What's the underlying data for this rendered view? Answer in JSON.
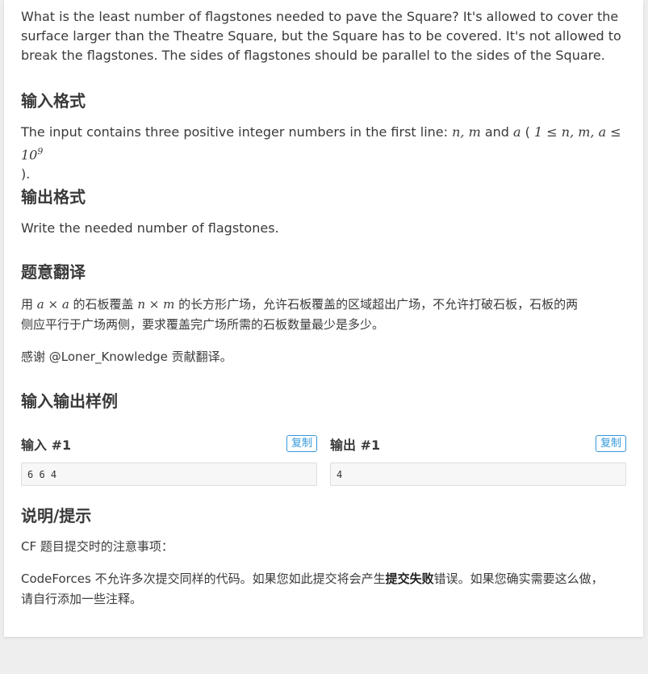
{
  "description": {
    "text": "What is the least number of flagstones needed to pave the Square? It's allowed to cover the surface larger than the Theatre Square, but the Square has to be covered. It's not allowed to break the flagstones. The sides of flagstones should be parallel to the sides of the Square."
  },
  "input_format": {
    "heading": "输入格式",
    "text_prefix": "The input contains three positive integer numbers in the first line: ",
    "vars_n": "n",
    "comma1": ", ",
    "vars_m": "m",
    "and_word": " and ",
    "vars_a": "a",
    "paren_open": " ( ",
    "constraint_one": "1 ",
    "leq1": "≤",
    "constraint_vars": " n, m, a ",
    "leq2": "≤",
    "constraint_base": " 10",
    "constraint_exp": "9",
    "paren_close": ")."
  },
  "output_format": {
    "heading": "输出格式",
    "text": "Write the needed number of flagstones."
  },
  "translation": {
    "heading": "题意翻译",
    "p1_pre": "用 ",
    "p1_math1": "a × a",
    "p1_mid": " 的石板覆盖 ",
    "p1_math2": "n × m",
    "p1_post_line1": " 的长方形广场，允许石板覆盖的区域超出广场，不允许打破石板，石板的两",
    "p1_line2": "侧应平行于广场两侧，要求覆盖完广场所需的石板数量最少是多少。",
    "p2": "感谢 @Loner_Knowledge 贡献翻译。"
  },
  "samples": {
    "heading": "输入输出样例",
    "input_title": "输入 #1",
    "output_title": "输出 #1",
    "copy_label": "复制",
    "input_value": "6 6 4",
    "output_value": "4"
  },
  "hints": {
    "heading": "说明/提示",
    "p1": "CF 题目提交时的注意事项：",
    "p2_pre": "CodeForces 不允许多次提交同样的代码。如果您如此提交将会产生",
    "p2_bold": "提交失败",
    "p2_post": "错误。如果您确实需要这么做，",
    "p2_line2": "请自行添加一些注释。"
  }
}
